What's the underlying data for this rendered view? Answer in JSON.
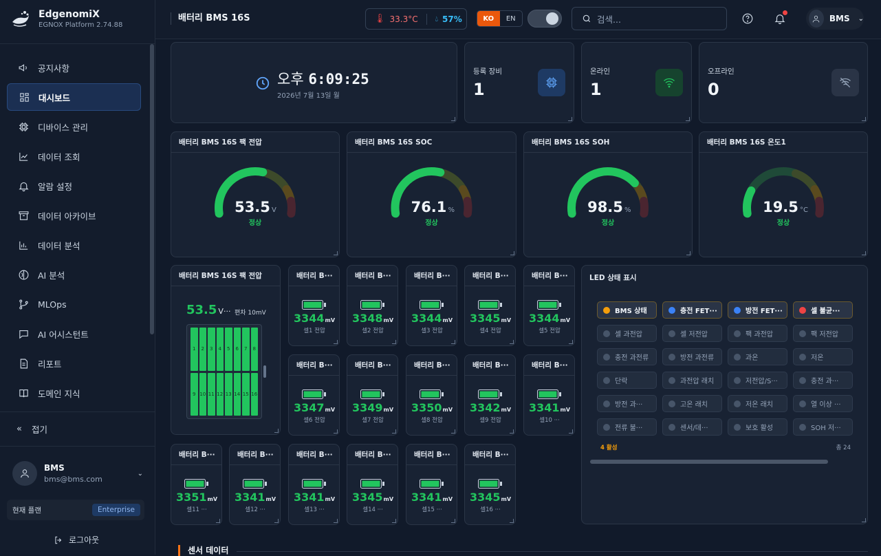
{
  "brand": {
    "name": "EdgenomiX",
    "version": "EGNOX Platform 2.74.88"
  },
  "nav": [
    {
      "label": "공지사항",
      "icon": "megaphone-icon",
      "active": false
    },
    {
      "label": "대시보드",
      "icon": "dashboard-icon",
      "active": true
    },
    {
      "label": "디바이스 관리",
      "icon": "chip-icon",
      "active": false
    },
    {
      "label": "데이터 조회",
      "icon": "line-chart-icon",
      "active": false
    },
    {
      "label": "알람 설정",
      "icon": "bell-icon",
      "active": false
    },
    {
      "label": "데이터 아카이브",
      "icon": "archive-icon",
      "active": false
    },
    {
      "label": "데이터 분석",
      "icon": "bar-chart-icon",
      "active": false
    },
    {
      "label": "AI 분석",
      "icon": "ai-icon",
      "active": false
    },
    {
      "label": "MLOps",
      "icon": "branch-icon",
      "active": false
    },
    {
      "label": "AI 어시스턴트",
      "icon": "chat-icon",
      "active": false
    },
    {
      "label": "리포트",
      "icon": "report-icon",
      "active": false
    },
    {
      "label": "도메인 지식",
      "icon": "book-icon",
      "active": false
    }
  ],
  "sidebar": {
    "collapse_label": "접기",
    "user_name": "BMS",
    "user_email": "bms@bms.com",
    "plan_label": "현재 플랜",
    "plan_value": "Enterprise",
    "logout_label": "로그아웃"
  },
  "header": {
    "title": "배터리 BMS 16S",
    "temperature": "33.3°C",
    "humidity": "57%",
    "lang_ko": "KO",
    "lang_en": "EN",
    "search_placeholder": "검색...",
    "user": "BMS"
  },
  "clock": {
    "ampm": "오후",
    "time": "6:09:25",
    "date": "2026년 7월 13일 월"
  },
  "stats": [
    {
      "label": "등록 장비",
      "value": "1",
      "icon": "chip-icon"
    },
    {
      "label": "온라인",
      "value": "1",
      "icon": "wifi-icon"
    },
    {
      "label": "오프라인",
      "value": "0",
      "icon": "wifi-off-icon"
    }
  ],
  "gauges": [
    {
      "title": "배터리 BMS 16S 팩 전압",
      "value": "53.5",
      "unit": "V",
      "status": "정상",
      "fraction": 0.75
    },
    {
      "title": "배터리 BMS 16S SOC",
      "value": "76.1",
      "unit": "%",
      "status": "정상",
      "fraction": 0.761
    },
    {
      "title": "배터리 BMS 16S SOH",
      "value": "98.5",
      "unit": "%",
      "status": "정상",
      "fraction": 0.985
    },
    {
      "title": "배터리 BMS 16S 온도1",
      "value": "19.5",
      "unit": "°C",
      "status": "정상",
      "fraction": 0.25
    }
  ],
  "pack": {
    "title": "배터리 BMS 16S 팩 전압",
    "value": "53.5",
    "unit": "V···",
    "deviation": "편차 10mV",
    "cells": [
      "1",
      "2",
      "3",
      "4",
      "5",
      "6",
      "7",
      "8",
      "9",
      "10",
      "11",
      "12",
      "13",
      "14",
      "15",
      "16"
    ]
  },
  "cells": [
    {
      "title": "배터리 B···",
      "value": "3344",
      "unit": "mV",
      "label": "셀1 전압"
    },
    {
      "title": "배터리 B···",
      "value": "3348",
      "unit": "mV",
      "label": "셀2 전압"
    },
    {
      "title": "배터리 B···",
      "value": "3344",
      "unit": "mV",
      "label": "셀3 전압"
    },
    {
      "title": "배터리 B···",
      "value": "3345",
      "unit": "mV",
      "label": "셀4 전압"
    },
    {
      "title": "배터리 B···",
      "value": "3344",
      "unit": "mV",
      "label": "셀5 전압"
    },
    {
      "title": "배터리 B···",
      "value": "3347",
      "unit": "mV",
      "label": "셀6 전압"
    },
    {
      "title": "배터리 B···",
      "value": "3349",
      "unit": "mV",
      "label": "셀7 전압"
    },
    {
      "title": "배터리 B···",
      "value": "3350",
      "unit": "mV",
      "label": "셀8 전압"
    },
    {
      "title": "배터리 B···",
      "value": "3342",
      "unit": "mV",
      "label": "셀9 전압"
    },
    {
      "title": "배터리 B···",
      "value": "3341",
      "unit": "mV",
      "label": "셀10 ···"
    },
    {
      "title": "배터리 B···",
      "value": "3351",
      "unit": "mV",
      "label": "셀11 ···"
    },
    {
      "title": "배터리 B···",
      "value": "3341",
      "unit": "mV",
      "label": "셀12 ···"
    },
    {
      "title": "배터리 B···",
      "value": "3341",
      "unit": "mV",
      "label": "셀13 ···"
    },
    {
      "title": "배터리 B···",
      "value": "3345",
      "unit": "mV",
      "label": "셀14 ···"
    },
    {
      "title": "배터리 B···",
      "value": "3341",
      "unit": "mV",
      "label": "셀15 ···"
    },
    {
      "title": "배터리 B···",
      "value": "3345",
      "unit": "mV",
      "label": "셀16 ···"
    }
  ],
  "led": {
    "title": "LED 상태 표시",
    "active_count": "4 활성",
    "total": "총 24",
    "items": [
      {
        "label": "BMS 상태",
        "color": "#f59e0b",
        "on": true
      },
      {
        "label": "충전 FET···",
        "color": "#3b82f6",
        "on": true
      },
      {
        "label": "방전 FET···",
        "color": "#3b82f6",
        "on": true
      },
      {
        "label": "셀 불균···",
        "color": "#ef4444",
        "on": true
      },
      {
        "label": "셀 과전압",
        "on": false
      },
      {
        "label": "셀 저전압",
        "on": false
      },
      {
        "label": "팩 과전압",
        "on": false
      },
      {
        "label": "팩 저전압",
        "on": false
      },
      {
        "label": "충전 과전류",
        "on": false
      },
      {
        "label": "방전 과전류",
        "on": false
      },
      {
        "label": "과온",
        "on": false
      },
      {
        "label": "저온",
        "on": false
      },
      {
        "label": "단락",
        "on": false
      },
      {
        "label": "과전압 래치",
        "on": false
      },
      {
        "label": "저전압/S···",
        "on": false
      },
      {
        "label": "충전 과···",
        "on": false
      },
      {
        "label": "방전 과···",
        "on": false
      },
      {
        "label": "고온 래치",
        "on": false
      },
      {
        "label": "저온 래치",
        "on": false
      },
      {
        "label": "열 이상 ···",
        "on": false
      },
      {
        "label": "전류 불···",
        "on": false
      },
      {
        "label": "센서/데···",
        "on": false
      },
      {
        "label": "보호 활성",
        "on": false
      },
      {
        "label": "SOH 저···",
        "on": false
      }
    ]
  },
  "sensor_section": "센서 데이터",
  "colors": {
    "accent": "#22c55e",
    "orange": "#f97316",
    "blue": "#3b82f6"
  }
}
